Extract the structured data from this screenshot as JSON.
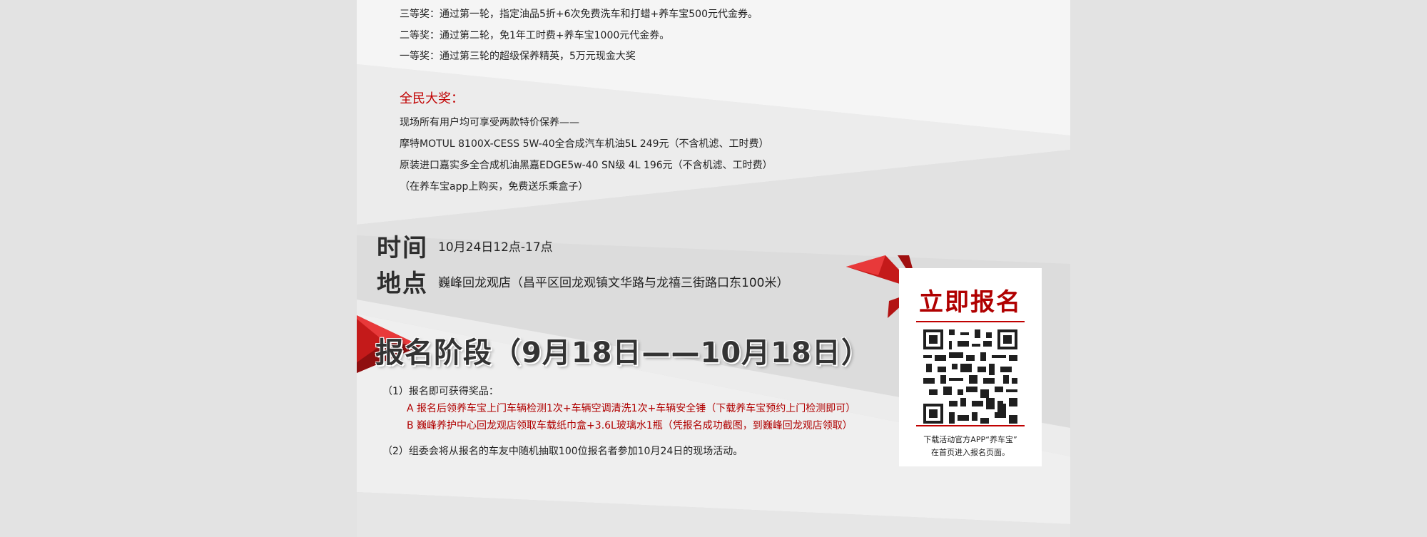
{
  "prizes": {
    "third": "三等奖：通过第一轮，指定油品5折+6次免费洗车和打蜡+养车宝500元代金券。",
    "second": "二等奖：通过第二轮，免1年工时费+养车宝1000元代金券。",
    "first": "一等奖：通过第三轮的超级保养精英，5万元现金大奖"
  },
  "grand_prize": {
    "heading": "全民大奖：",
    "lines": [
      "现场所有用户均可享受两款特价保养——",
      "摩特MOTUL 8100X-CESS 5W-40全合成汽车机油5L  249元（不含机滤、工时费）",
      "原装进口嘉实多全合成机油黑嘉EDGE5w-40 SN级 4L 196元（不含机滤、工时费）",
      "（在养车宝app上购买，免费送乐乘盒子）"
    ]
  },
  "event": {
    "time_label": "时间",
    "time_value": "10月24日12点-17点",
    "place_label": "地点",
    "place_value": "巍峰回龙观店（昌平区回龙观镇文华路与龙禧三街路口东100米）"
  },
  "registration": {
    "title": "报名阶段（9月18日——10月18日）",
    "item1": "（1）报名即可获得奖品：",
    "item1_a": "A 报名后领养车宝上门车辆检测1次+车辆空调清洗1次+车辆安全锤（下载养车宝预约上门检测即可）",
    "item1_b": "B 巍峰养护中心回龙观店领取车载纸巾盒+3.6L玻璃水1瓶（凭报名成功截图，到巍峰回龙观店领取）",
    "item2": "（2）组委会将从报名的车友中随机抽取100位报名者参加10月24日的现场活动。"
  },
  "qr": {
    "title": "立即报名",
    "caption_line1": "下载活动官方APP“养车宝”",
    "caption_line2": "在首页进入报名页面。",
    "icon": "qr-code-icon"
  },
  "colors": {
    "accent": "#c00000",
    "dark_red": "#8b0000"
  }
}
